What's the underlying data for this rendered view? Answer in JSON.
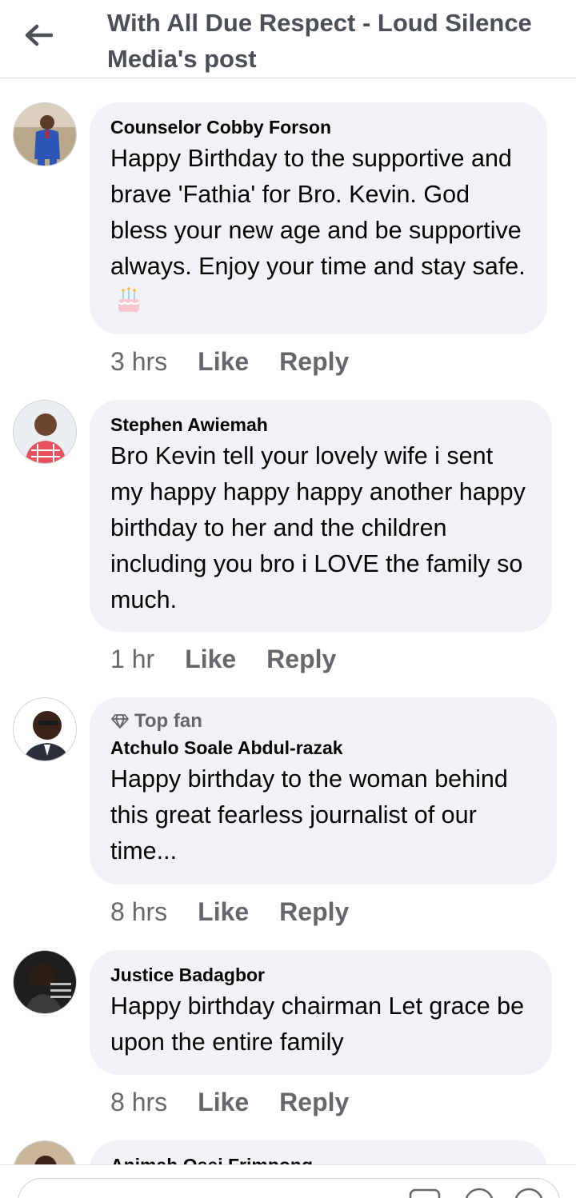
{
  "header": {
    "title": "With All Due Respect - Loud Silence Media's post",
    "back_icon": "arrow-left-icon"
  },
  "comments": [
    {
      "author": "Counselor Cobby Forson",
      "text": "Happy Birthday to the supportive and brave 'Fathia' for Bro. Kevin. God bless your new age and be supportive always. Enjoy your time and stay safe.",
      "emoji": "birthday-cake-icon",
      "time": "3 hrs",
      "like": "Like",
      "reply": "Reply"
    },
    {
      "author": "Stephen Awiemah",
      "text": "Bro Kevin tell your lovely wife i sent my happy happy happy another happy birthday to her and the children including you bro i LOVE the family so much.",
      "time": "1 hr",
      "like": "Like",
      "reply": "Reply"
    },
    {
      "badge": "Top fan",
      "badge_icon": "diamond-icon",
      "author": "Atchulo Soale Abdul-razak",
      "text": "Happy birthday to the woman behind this great fearless journalist of our time...",
      "time": "8 hrs",
      "like": "Like",
      "reply": "Reply"
    },
    {
      "author": "Justice Badagbor",
      "text": "Happy birthday chairman Let grace be upon the entire family",
      "time": "8 hrs",
      "like": "Like",
      "reply": "Reply"
    },
    {
      "author": "Animah Osei Frimpong",
      "partial": true
    }
  ],
  "colors": {
    "bubble": "#f0f2f5",
    "secondary_text": "#65676b",
    "primary_text": "#050505"
  }
}
